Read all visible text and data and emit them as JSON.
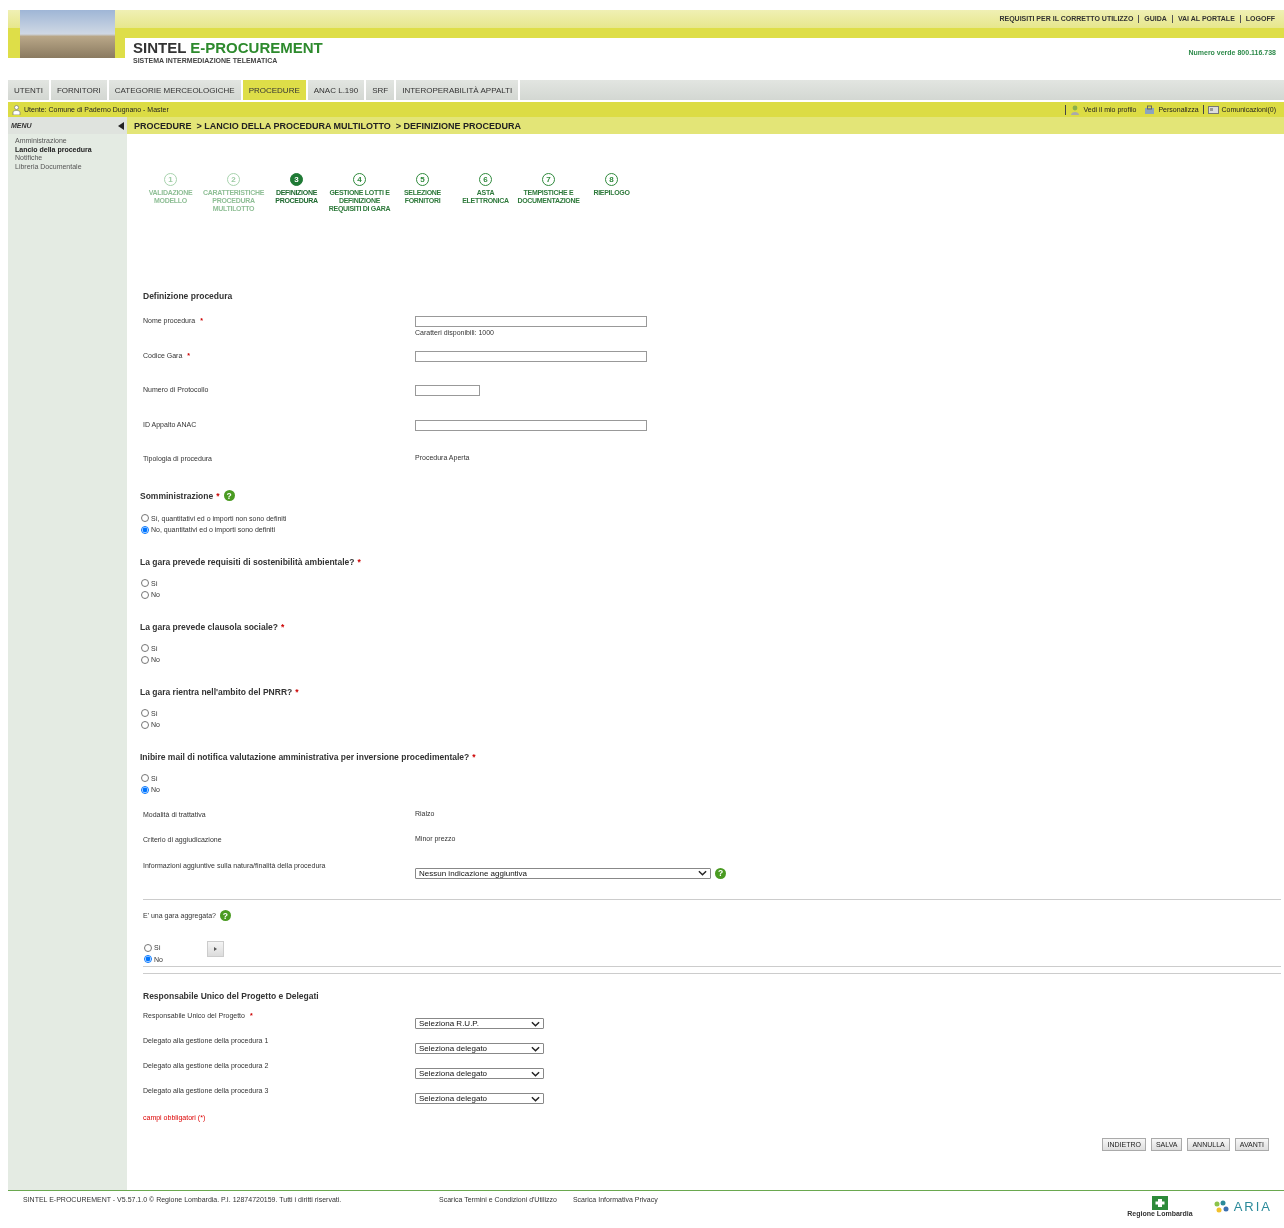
{
  "header": {
    "top_links": [
      "REQUISITI PER IL CORRETTO UTILIZZO",
      "GUIDA",
      "VAI AL PORTALE",
      "LOGOFF"
    ],
    "title_main": "SINTEL",
    "title_accent": "E-PROCUREMENT",
    "subtitle": "SISTEMA INTERMEDIAZIONE TELEMATICA",
    "phone": "Numero verde 800.116.738"
  },
  "nav_tabs": [
    {
      "label": "UTENTI",
      "selected": false
    },
    {
      "label": "FORNITORI",
      "selected": false
    },
    {
      "label": "CATEGORIE MERCEOLOGICHE",
      "selected": false
    },
    {
      "label": "PROCEDURE",
      "selected": true
    },
    {
      "label": "ANAC L.190",
      "selected": false
    },
    {
      "label": "SRF",
      "selected": false
    },
    {
      "label": "INTEROPERABILITÀ APPALTI",
      "selected": false
    }
  ],
  "user_bar": {
    "user": "Utente: Comune di Paderno Dugnano - Master",
    "links": [
      {
        "kind": "profile",
        "label": "Vedi il mio profilo"
      },
      {
        "kind": "customize",
        "label": "Personalizza"
      },
      {
        "kind": "messages",
        "label": "Comunicazioni(0)"
      }
    ]
  },
  "sidebar": {
    "title": "MENU",
    "items": [
      {
        "label": "Amministrazione",
        "selected": false
      },
      {
        "label": "Lancio della procedura",
        "selected": true
      },
      {
        "label": "Notifiche",
        "selected": false
      },
      {
        "label": "Libreria Documentale",
        "selected": false
      }
    ]
  },
  "breadcrumb": [
    "PROCEDURE",
    "> LANCIO DELLA PROCEDURA MULTILOTTO",
    "> DEFINIZIONE PROCEDURA"
  ],
  "steps": [
    {
      "number": "1",
      "label": "VALIDAZIONE MODELLO",
      "selected": false,
      "disabled": true
    },
    {
      "number": "2",
      "label": "CARATTERISTICHE PROCEDURA MULTILOTTO",
      "selected": false,
      "disabled": true
    },
    {
      "number": "3",
      "label": "DEFINIZIONE PROCEDURA",
      "selected": true,
      "disabled": false
    },
    {
      "number": "4",
      "label": "GESTIONE LOTTI E DEFINIZIONE REQUISITI DI GARA",
      "selected": false,
      "disabled": false
    },
    {
      "number": "5",
      "label": "SELEZIONE FORNITORI",
      "selected": false,
      "disabled": false
    },
    {
      "number": "6",
      "label": "ASTA ELETTRONICA",
      "selected": false,
      "disabled": false
    },
    {
      "number": "7",
      "label": "TEMPISTICHE E DOCUMENTAZIONE",
      "selected": false,
      "disabled": false
    },
    {
      "number": "8",
      "label": "RIEPILOGO",
      "selected": false,
      "disabled": false
    }
  ],
  "form": {
    "title": "Definizione procedura",
    "fields": [
      {
        "kind": "text",
        "label": "Nome procedura",
        "required_mark": "*",
        "hint": "Caratteri disponibili: 1000"
      },
      {
        "kind": "text",
        "label": "Codice Gara",
        "required_mark": "*"
      },
      {
        "kind": "short_text",
        "label": "Numero di Protocollo"
      },
      {
        "kind": "text",
        "label": "ID Appalto ANAC"
      },
      {
        "kind": "static",
        "label": "Tipologia di procedura",
        "value": "Procedura Aperta"
      }
    ],
    "questions": [
      {
        "title": "Somministrazione",
        "required_mark": "*",
        "help": "?",
        "options": [
          {
            "label": "Sì, quantitativi ed o importi non sono definiti",
            "selected": false
          },
          {
            "label": "No, quantitativi ed o importi sono definiti",
            "selected": true
          }
        ]
      },
      {
        "title": "La gara prevede requisiti di sostenibilità ambientale?",
        "required_mark": "*",
        "options": [
          {
            "label": "Sì",
            "selected": false
          },
          {
            "label": "No",
            "selected": false
          }
        ]
      },
      {
        "title": "La gara prevede clausola sociale?",
        "required_mark": "*",
        "options": [
          {
            "label": "Sì",
            "selected": false
          },
          {
            "label": "No",
            "selected": false
          }
        ]
      },
      {
        "title": "La gara rientra nell'ambito del PNRR?",
        "required_mark": "*",
        "options": [
          {
            "label": "Sì",
            "selected": false
          },
          {
            "label": "No",
            "selected": false
          }
        ]
      },
      {
        "title": "Inibire mail di notifica valutazione amministrativa per inversione procedimentale?",
        "required_mark": "*",
        "options": [
          {
            "label": "Sì",
            "selected": false
          },
          {
            "label": "No",
            "selected": true
          }
        ]
      }
    ],
    "details": [
      {
        "kind": "static",
        "label": "Modalità di trattativa",
        "value": "Rialzo"
      },
      {
        "kind": "static",
        "label": "Criterio di aggiudicazione",
        "value": "Minor prezzo"
      },
      {
        "kind": "select",
        "label": "Informazioni aggiuntive sulla natura/finalità della procedura",
        "value": "Nessun indicazione aggiuntiva",
        "help": "?"
      }
    ]
  },
  "aggregata": {
    "label": "E' una gara aggregata?",
    "help": "?",
    "options": [
      {
        "label": "Sì",
        "selected": false
      },
      {
        "label": "No",
        "selected": true
      }
    ]
  },
  "rup": {
    "title": "Responsabile Unico del Progetto e Delegati",
    "fields": [
      {
        "kind": "select",
        "label": "Responsabile Unico del Progetto",
        "required_mark": "*",
        "value": "Seleziona R.U.P."
      },
      {
        "kind": "select",
        "label": "Delegato alla gestione della procedura  1",
        "value": "Seleziona delegato"
      },
      {
        "kind": "select",
        "label": "Delegato alla gestione della procedura  2",
        "value": "Seleziona delegato"
      },
      {
        "kind": "select",
        "label": "Delegato alla gestione della procedura  3",
        "value": "Seleziona delegato"
      }
    ]
  },
  "required_note": "campi obbligatori (*)",
  "buttons": [
    "INDIETRO",
    "SALVA",
    "ANNULLA",
    "AVANTI"
  ],
  "footer": {
    "copyright": "SINTEL E-PROCUREMENT - V5.57.1.0 © Regione Lombardia. P.I. 12874720159. Tutti i diritti riservati.",
    "links": [
      "Scarica Termini e Condizioni d'Utilizzo",
      "Scarica Informativa Privacy"
    ],
    "logo_left": "Regione Lombardia",
    "logo_right": "ARIA"
  }
}
